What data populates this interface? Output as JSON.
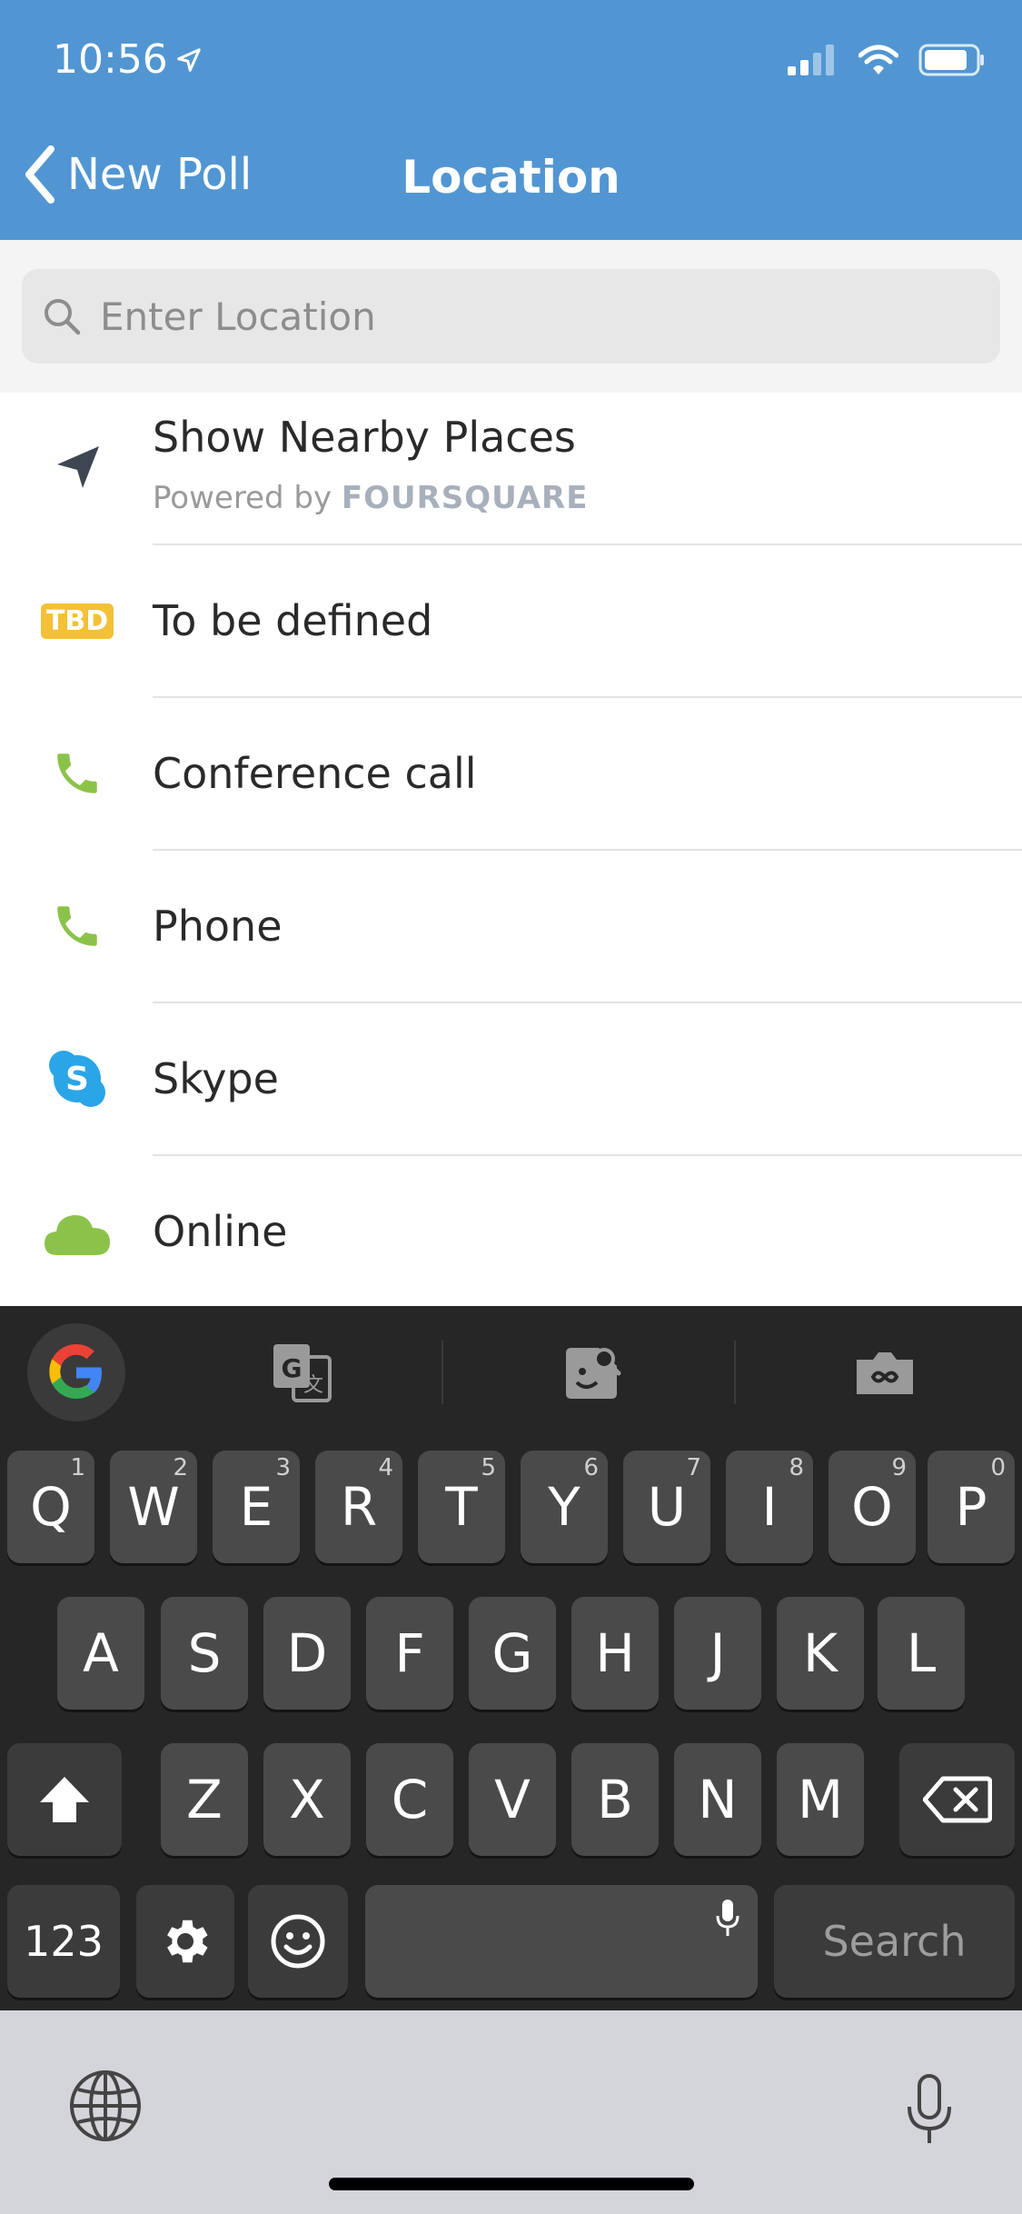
{
  "status_bar": {
    "time": "10:56"
  },
  "header": {
    "back_label": "New Poll",
    "title": "Location"
  },
  "search": {
    "placeholder": "Enter Location",
    "value": ""
  },
  "list": [
    {
      "label": "Show Nearby Places",
      "sublabel_prefix": "Powered by",
      "sublabel_brand": "FOURSQUARE",
      "icon": "location-arrow-icon"
    },
    {
      "label": "To be defined",
      "icon": "tbd-icon",
      "icon_text": "TBD"
    },
    {
      "label": "Conference call",
      "icon": "phone-icon"
    },
    {
      "label": "Phone",
      "icon": "phone-icon"
    },
    {
      "label": "Skype",
      "icon": "skype-icon"
    },
    {
      "label": "Online",
      "icon": "cloud-icon"
    }
  ],
  "keyboard": {
    "row1": [
      {
        "k": "Q",
        "h": "1"
      },
      {
        "k": "W",
        "h": "2"
      },
      {
        "k": "E",
        "h": "3"
      },
      {
        "k": "R",
        "h": "4"
      },
      {
        "k": "T",
        "h": "5"
      },
      {
        "k": "Y",
        "h": "6"
      },
      {
        "k": "U",
        "h": "7"
      },
      {
        "k": "I",
        "h": "8"
      },
      {
        "k": "O",
        "h": "9"
      },
      {
        "k": "P",
        "h": "0"
      }
    ],
    "row2": [
      "A",
      "S",
      "D",
      "F",
      "G",
      "H",
      "J",
      "K",
      "L"
    ],
    "row3": [
      "Z",
      "X",
      "C",
      "V",
      "B",
      "N",
      "M"
    ],
    "numbers_label": "123",
    "search_label": "Search"
  },
  "colors": {
    "header": "#5196d2",
    "green": "#8bc34a",
    "tbd": "#f3c037",
    "skype": "#2aa5e8"
  }
}
